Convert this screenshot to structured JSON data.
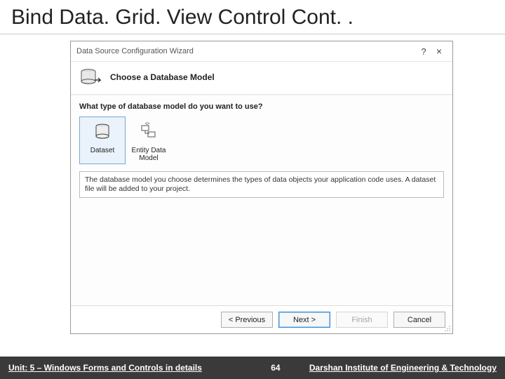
{
  "slide": {
    "title": "Bind Data. Grid. View Control Cont. .",
    "footer_unit": "Unit: 5 – Windows Forms and Controls in details",
    "page_number": "64",
    "footer_org": "Darshan Institute of Engineering & Technology"
  },
  "wizard": {
    "window_title": "Data Source Configuration Wizard",
    "help_label": "?",
    "close_label": "×",
    "banner_title": "Choose a Database Model",
    "prompt": "What type of database model do you want to use?",
    "models": {
      "dataset": "Dataset",
      "entity": "Entity Data Model"
    },
    "hint": "The database model you choose determines the types of data objects your application code uses. A dataset file will be added to your project.",
    "buttons": {
      "previous": "< Previous",
      "next": "Next >",
      "finish": "Finish",
      "cancel": "Cancel"
    }
  }
}
